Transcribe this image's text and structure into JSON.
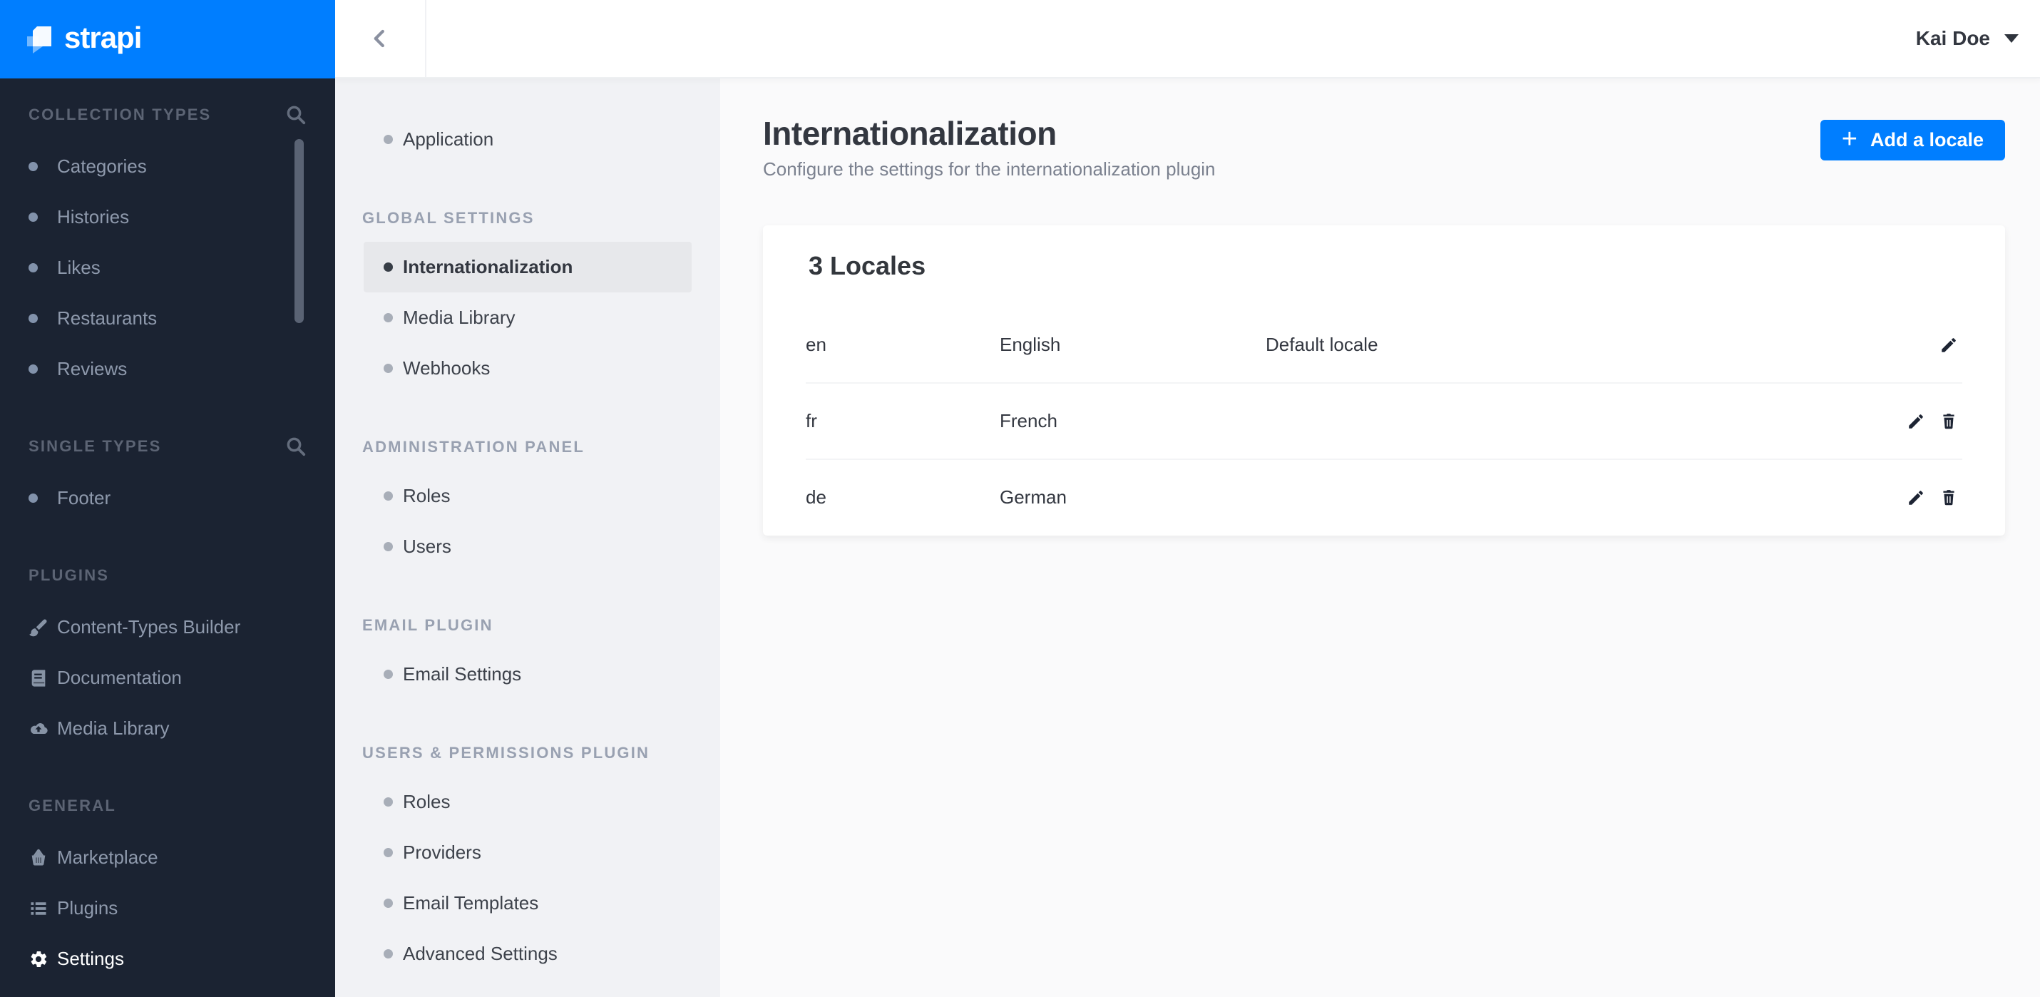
{
  "brand": {
    "wordmark": "strapi"
  },
  "topbar": {
    "user_name": "Kai Doe"
  },
  "left_sidebar": {
    "sections": [
      {
        "label": "COLLECTION TYPES",
        "has_search": true,
        "items": [
          {
            "label": "Categories"
          },
          {
            "label": "Histories"
          },
          {
            "label": "Likes"
          },
          {
            "label": "Restaurants"
          },
          {
            "label": "Reviews"
          }
        ]
      },
      {
        "label": "SINGLE TYPES",
        "has_search": true,
        "items": [
          {
            "label": "Footer"
          }
        ]
      },
      {
        "label": "PLUGINS",
        "items": [
          {
            "label": "Content-Types Builder",
            "icon": "paintbrush-icon"
          },
          {
            "label": "Documentation",
            "icon": "book-icon"
          },
          {
            "label": "Media Library",
            "icon": "cloud-upload-icon"
          }
        ]
      },
      {
        "label": "GENERAL",
        "items": [
          {
            "label": "Marketplace",
            "icon": "basket-icon"
          },
          {
            "label": "Plugins",
            "icon": "list-icon"
          },
          {
            "label": "Settings",
            "icon": "gear-icon",
            "active": true
          }
        ]
      }
    ]
  },
  "settings_menu": {
    "groups": [
      {
        "label": "",
        "items": [
          {
            "label": "Application"
          }
        ]
      },
      {
        "label": "GLOBAL SETTINGS",
        "items": [
          {
            "label": "Internationalization",
            "active": true
          },
          {
            "label": "Media Library"
          },
          {
            "label": "Webhooks"
          }
        ]
      },
      {
        "label": "ADMINISTRATION PANEL",
        "items": [
          {
            "label": "Roles"
          },
          {
            "label": "Users"
          }
        ]
      },
      {
        "label": "EMAIL PLUGIN",
        "items": [
          {
            "label": "Email Settings"
          }
        ]
      },
      {
        "label": "USERS & PERMISSIONS PLUGIN",
        "items": [
          {
            "label": "Roles"
          },
          {
            "label": "Providers"
          },
          {
            "label": "Email Templates"
          },
          {
            "label": "Advanced Settings"
          }
        ]
      }
    ]
  },
  "page": {
    "title": "Internationalization",
    "subtitle": "Configure the settings for the internationalization plugin",
    "add_locale_button": "Add a locale",
    "card": {
      "title": "3 Locales",
      "rows": [
        {
          "code": "en",
          "name": "English",
          "note": "Default locale"
        },
        {
          "code": "fr",
          "name": "French",
          "note": ""
        },
        {
          "code": "de",
          "name": "German",
          "note": ""
        }
      ]
    }
  },
  "colors": {
    "primary_blue": "#007eff",
    "sidebar_dark": "#1b2332",
    "settings_sidebar_bg": "#f1f2f5",
    "main_bg": "#fafafb",
    "active_item_bg": "#e7e8eb",
    "text_dark": "#333740",
    "text_muted": "#7b818f"
  }
}
